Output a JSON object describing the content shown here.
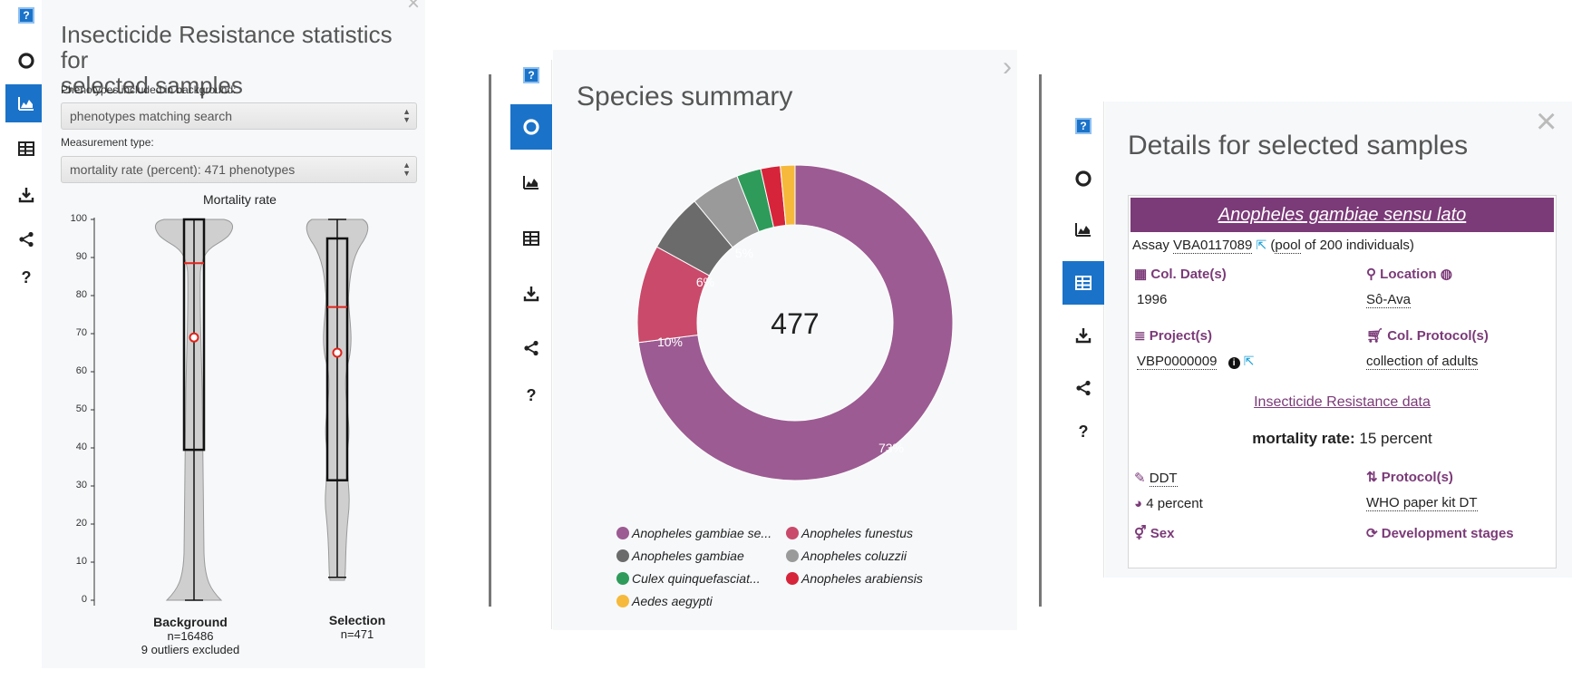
{
  "left_panel": {
    "title_line1": "Insecticide Resistance statistics for",
    "title_line2": "selected samples",
    "phenotypes_label": "Phenotypes included in background:",
    "phenotypes_select": "phenotypes matching search",
    "measurement_label": "Measurement type:",
    "measurement_select": "mortality rate (percent): 471 phenotypes",
    "chart_title": "Mortality rate",
    "y_ticks": [
      "100",
      "90",
      "80",
      "70",
      "60",
      "50",
      "40",
      "30",
      "20",
      "10",
      "0"
    ],
    "background_label": "Background",
    "background_n": "n=16486",
    "background_outliers": "9 outliers excluded",
    "selection_label": "Selection",
    "selection_n": "n=471"
  },
  "middle_panel": {
    "title": "Species summary",
    "center_total": "477",
    "slice_labels": {
      "s1": "73%",
      "s2": "10%",
      "s3": "6%",
      "s4": "5%"
    },
    "legend": [
      {
        "label": "Anopheles gambiae se...",
        "color": "#9c5b92"
      },
      {
        "label": "Anopheles funestus",
        "color": "#c94a6b"
      },
      {
        "label": "Anopheles gambiae",
        "color": "#6b6b6b"
      },
      {
        "label": "Anopheles coluzzii",
        "color": "#9a9a9a"
      },
      {
        "label": "Culex quinquefasciat...",
        "color": "#2e9b5a"
      },
      {
        "label": "Anopheles arabiensis",
        "color": "#d6243a"
      },
      {
        "label": "Aedes aegypti",
        "color": "#f6b93b"
      }
    ]
  },
  "right_panel": {
    "title": "Details for selected samples",
    "species": "Anopheles gambiae sensu lato",
    "assay_prefix": "Assay",
    "assay_id": "VBA0117089",
    "pool_text_open": "(",
    "pool_link": "pool",
    "pool_text_rest": "of 200 individuals)",
    "col_date_head": "Col. Date(s)",
    "col_date_value": "1996",
    "location_head": "Location",
    "location_value": "Sô-Ava",
    "projects_head": "Project(s)",
    "project_value": "VBP0000009",
    "col_protocol_head": "Col. Protocol(s)",
    "col_protocol_value": "collection of adults",
    "ir_link": "Insecticide Resistance data",
    "mortality_label": "mortality rate:",
    "mortality_value": "15 percent",
    "insecticide_value": "DDT",
    "protocols_head": "Protocol(s)",
    "concentration_value": "4 percent",
    "protocol_value": "WHO paper kit DT",
    "sex_head": "Sex",
    "dev_stages_head": "Development stages"
  },
  "toolbar": {
    "help_glyph": "?",
    "question_glyph": "?"
  },
  "chart_data": [
    {
      "type": "pie",
      "title": "",
      "categories": [
        "Anopheles gambiae se...",
        "Anopheles funestus",
        "Anopheles gambiae",
        "Anopheles coluzzii",
        "Culex quinquefasciat...",
        "Anopheles arabiensis",
        "Aedes aegypti"
      ],
      "values": [
        73,
        10,
        6,
        5,
        2.5,
        2,
        1.5
      ],
      "center_label": "477",
      "colors": [
        "#9c5b92",
        "#c94a6b",
        "#6b6b6b",
        "#9a9a9a",
        "#2e9b5a",
        "#d6243a",
        "#f6b93b"
      ],
      "legend_placement": "bottom"
    },
    {
      "type": "box",
      "title": "Mortality rate",
      "ylabel": "",
      "ylim": [
        0,
        100
      ],
      "series": [
        {
          "name": "Background",
          "min": 0,
          "q1": 39.5,
          "median": 88.5,
          "q3": 100,
          "max": 100,
          "mean": 69
        },
        {
          "name": "Selection",
          "min": 6,
          "q1": 31.5,
          "median": 77,
          "q3": 95,
          "max": 100,
          "mean": 65
        }
      ]
    }
  ]
}
